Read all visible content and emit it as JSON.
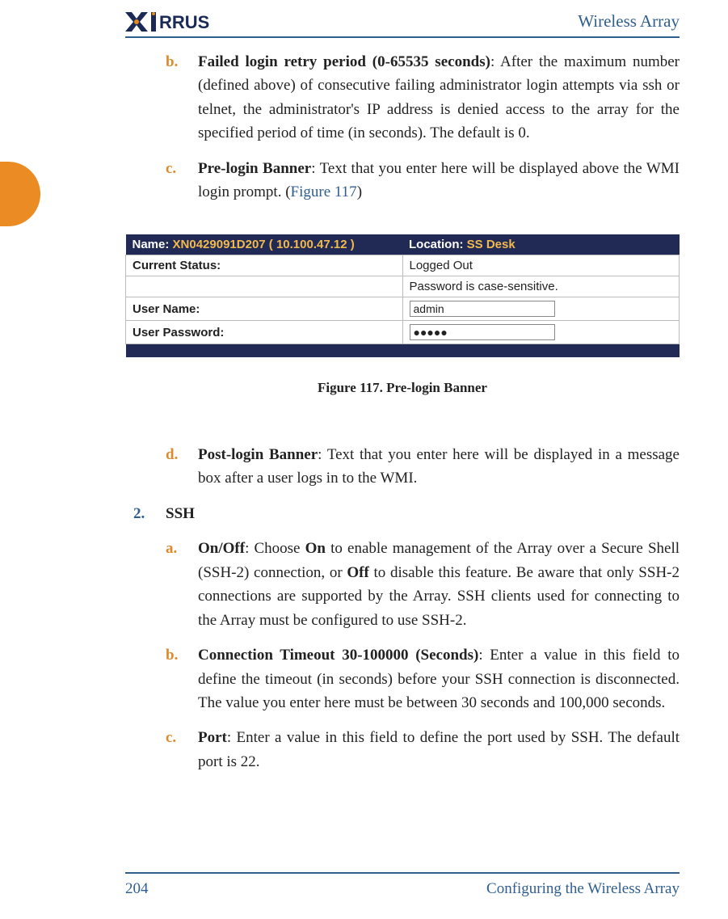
{
  "header": {
    "product": "Wireless Array",
    "logo_text": "XIRRUS"
  },
  "items_top": [
    {
      "marker": "b.",
      "lead": "Failed login retry period (0-65535 seconds)",
      "rest": ": After the maximum number (defined above) of consecutive failing administrator login attempts via ssh or telnet, the administrator's IP address is denied access to the array for the specified period of time (in seconds). The default is 0."
    },
    {
      "marker": "c.",
      "lead": "Pre-login Banner",
      "rest": ": Text that you enter here will be displayed above the WMI login prompt. (",
      "link": "Figure 117",
      "after_link": ")"
    }
  ],
  "figure": {
    "name_label": "Name:",
    "name_value": "XN0429091D207   ( 10.100.47.12 )",
    "location_label": "Location:",
    "location_value": "SS Desk",
    "status_label": "Current Status:",
    "status_value": "Logged Out",
    "hint": "Password is case-sensitive.",
    "user_label": "User Name:",
    "user_value": "admin",
    "pass_label": "User Password:",
    "pass_value": "●●●●●",
    "caption": "Figure 117. Pre-login Banner"
  },
  "item_d": {
    "marker": "d.",
    "lead": "Post-login Banner",
    "rest": ": Text that you enter here will be displayed in a message box after a user logs in to the WMI."
  },
  "section2": {
    "num": "2.",
    "title": "SSH",
    "items": [
      {
        "marker": "a.",
        "lead": "On/Off",
        "rest_before_b1": ": Choose ",
        "b1": "On",
        "rest_mid": " to enable management of the Array over a Secure Shell (SSH-2) connection, or ",
        "b2": "Off",
        "rest_after": " to disable this feature. Be aware that only SSH-2 connections are supported by the Array. SSH clients used for connecting to the Array must be configured to use SSH-2."
      },
      {
        "marker": "b.",
        "lead": "Connection Timeout 30-100000 (Seconds)",
        "rest": ": Enter a value in this field to define the timeout (in seconds) before your SSH connection is disconnected. The value you enter here must be between 30 seconds and 100,000 seconds."
      },
      {
        "marker": "c.",
        "lead": "Port",
        "rest": ": Enter a value in this field to define the port used by SSH. The default port is 22."
      }
    ]
  },
  "footer": {
    "page": "204",
    "chapter": "Configuring the Wireless Array"
  }
}
